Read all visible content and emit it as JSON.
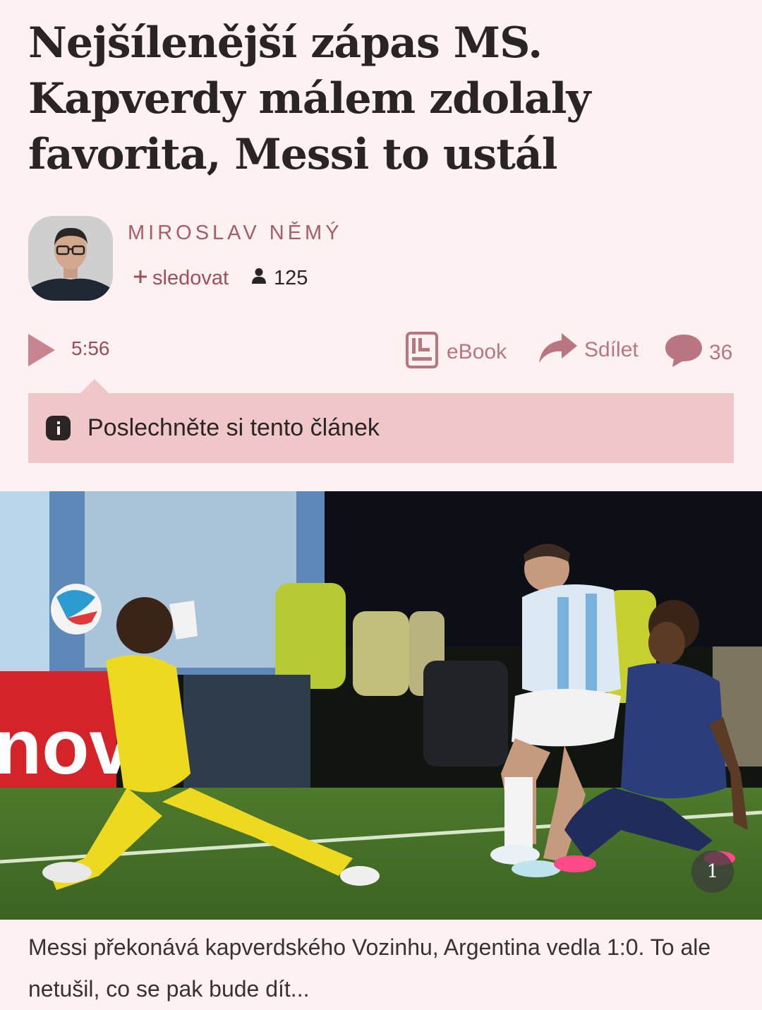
{
  "article": {
    "headline": "Nejšílenější zápas MS. Kapverdy málem zdolaly favorita, Messi to ustál"
  },
  "author": {
    "name": "MIROSLAV NĚMÝ",
    "follow_label": "sledovat",
    "followers": "125"
  },
  "toolbar": {
    "duration": "5:56",
    "ebook_label": "eBook",
    "share_label": "Sdílet",
    "comments_count": "36"
  },
  "tooltip": {
    "text": "Poslechněte si tento článek"
  },
  "photo": {
    "index_badge": "1",
    "caption": "Messi překonává kapverdského Vozinhu, Argentina vedla 1:0. To ale netušil, co se pak bude dít..."
  },
  "colors": {
    "background": "#fdf1f1",
    "accent": "#a85c67",
    "tooltip_bg": "#f0c7c9",
    "text": "#2b2424"
  },
  "icons": [
    "user-icon",
    "plus-icon",
    "play-icon",
    "ebook-icon",
    "share-icon",
    "comment-icon",
    "info-icon"
  ]
}
